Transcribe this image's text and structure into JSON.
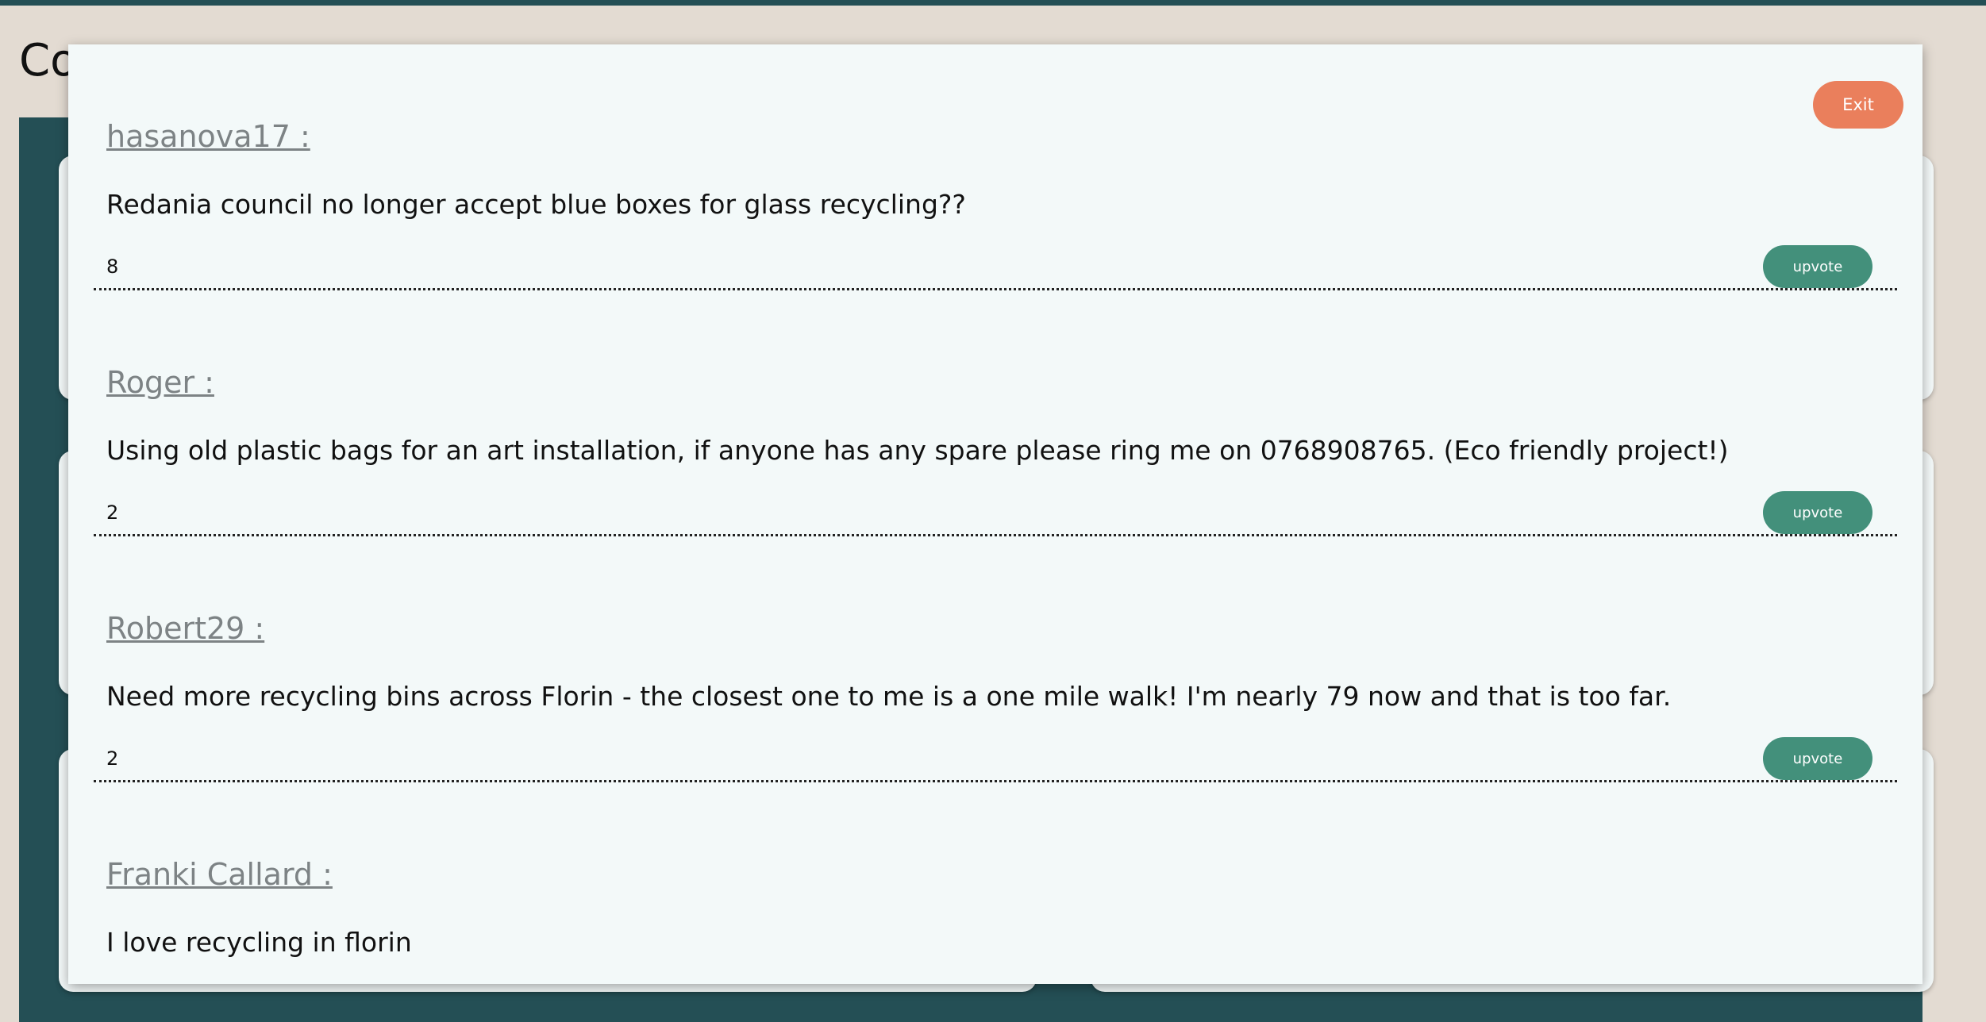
{
  "page": {
    "heading": "Co"
  },
  "modal": {
    "exit_label": "Exit",
    "posts": [
      {
        "author": "hasanova17 :",
        "text": "Redania council no longer accept blue boxes for glass recycling??",
        "votes": "8",
        "upvote_label": "upvote"
      },
      {
        "author": "Roger :",
        "text": "Using old plastic bags for an art installation, if anyone has any spare please ring me on 0768908765. (Eco friendly project!)",
        "votes": "2",
        "upvote_label": "upvote"
      },
      {
        "author": "Robert29 :",
        "text": "Need more recycling bins across Florin - the closest one to me is a one mile walk! I'm nearly 79 now and that is too far.",
        "votes": "2",
        "upvote_label": "upvote"
      },
      {
        "author": "Franki Callard :",
        "text": "I love recycling in florin"
      }
    ]
  },
  "colors": {
    "header_bar": "#244f55",
    "page_background": "#e3dbd2",
    "modal_background": "#f3f9f9",
    "exit_button": "#ea7f5c",
    "upvote_button": "#43907b",
    "author_text": "#7d8385"
  }
}
